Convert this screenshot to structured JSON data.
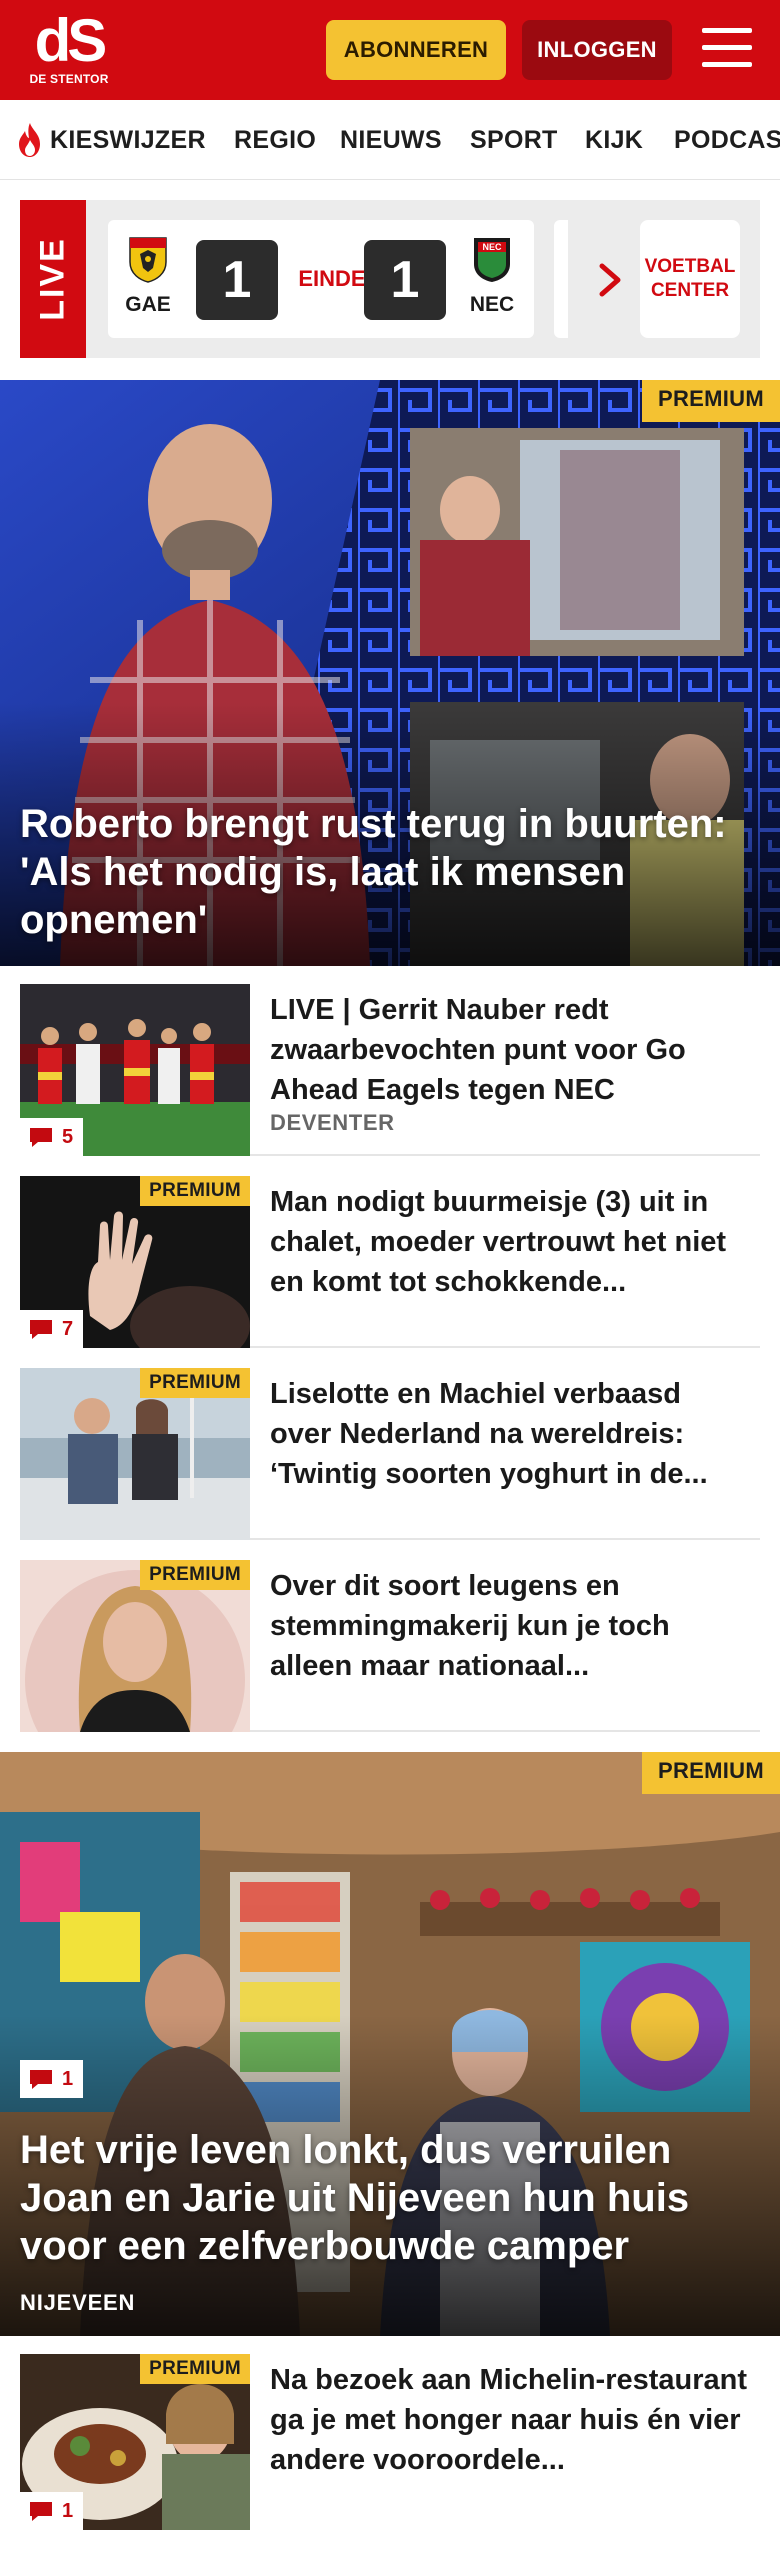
{
  "header": {
    "logo_text": "dS",
    "logo_subtitle": "DE STENTOR",
    "subscribe_label": "ABONNEREN",
    "login_label": "INLOGGEN",
    "brand_color": "#d10a11",
    "accent_color": "#f4c232"
  },
  "nav": {
    "items": [
      "KIESWIJZER",
      "REGIO",
      "NIEUWS",
      "SPORT",
      "KIJK",
      "PODCAS"
    ]
  },
  "live": {
    "label": "LIVE",
    "match": {
      "home_team": "GAE",
      "away_team": "NEC",
      "home_score": "1",
      "away_score": "1",
      "status": "EINDE"
    },
    "voetbal_center_label": "VOETBAL CENTER"
  },
  "hero1": {
    "badge": "PREMIUM",
    "title": "Roberto brengt rust terug in buurten: 'Als het nodig is, laat ik mensen opnemen'"
  },
  "articles": [
    {
      "title": "LIVE | Gerrit Nauber redt zwaarbevochten punt voor Go Ahead Eagels tegen NEC",
      "tag": "DEVENTER",
      "comments": "5",
      "premium": ""
    },
    {
      "title": "Man nodigt buurmeisje (3) uit in chalet, moeder vertrouwt het niet en komt tot schokkende...",
      "comments": "7",
      "premium": "PREMIUM"
    },
    {
      "title": "Liselotte en Machiel verbaasd over Nederland na wereldreis: ‘Twintig soorten yoghurt in de...",
      "premium": "PREMIUM"
    },
    {
      "title": "Over dit soort leugens en stemmingmakerij kun je toch alleen maar nationaal...",
      "premium": "PREMIUM"
    }
  ],
  "hero2": {
    "badge": "PREMIUM",
    "comments": "1",
    "title": "Het vrije leven lonkt, dus verruilen Joan en Jarie uit Nijeveen hun huis voor een zelfverbouwde camper",
    "tag": "NIJEVEEN"
  },
  "article_bottom": {
    "title": "Na bezoek aan Michelin-restaurant ga je met honger naar huis én vier andere vooroordele...",
    "comments": "1",
    "premium": "PREMIUM"
  }
}
